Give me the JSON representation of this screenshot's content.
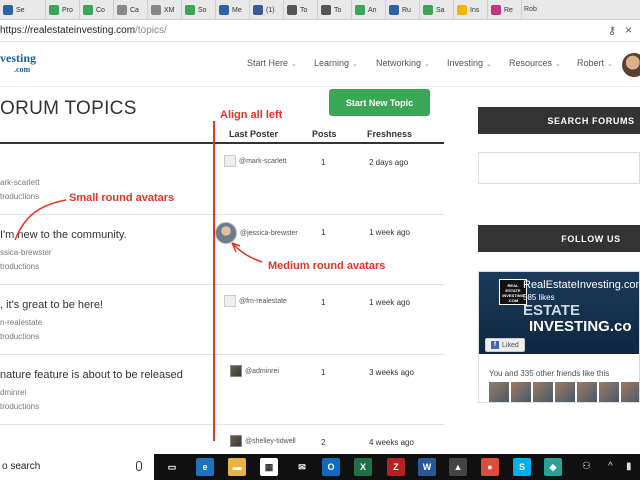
{
  "browser": {
    "tabs": [
      {
        "label": "Se",
        "color": "#2a62a8"
      },
      {
        "label": "Pro",
        "color": "#3aa757"
      },
      {
        "label": "Co",
        "color": "#3aa757"
      },
      {
        "label": "Ca",
        "color": "#888888"
      },
      {
        "label": "XM",
        "color": "#888888"
      },
      {
        "label": "So",
        "color": "#3aa757"
      },
      {
        "label": "Me",
        "color": "#2a62a8"
      },
      {
        "label": "(1)",
        "color": "#3b5998"
      },
      {
        "label": "To",
        "color": "#555555"
      },
      {
        "label": "To",
        "color": "#555555"
      },
      {
        "label": "An",
        "color": "#3aa757"
      },
      {
        "label": "Ru",
        "color": "#2a62a8"
      },
      {
        "label": "Sa",
        "color": "#3aa757"
      },
      {
        "label": "Ins",
        "color": "#f4b400"
      },
      {
        "label": "Re",
        "color": "#c13584"
      }
    ],
    "tab_overflow": "Rob",
    "url_host": "https://realestateinvesting.com",
    "url_path": "/topics/"
  },
  "site": {
    "logo_text": "vesting",
    "logo_sub": ".com",
    "nav": [
      {
        "label": "Start Here"
      },
      {
        "label": "Learning"
      },
      {
        "label": "Networking"
      },
      {
        "label": "Investing"
      },
      {
        "label": "Resources"
      },
      {
        "label": "Robert"
      }
    ]
  },
  "main": {
    "title": "ORUM TOPICS",
    "new_topic_label": "Start New Topic",
    "columns": {
      "last_poster": "Last Poster",
      "posts": "Posts",
      "freshness": "Freshness"
    },
    "topics": [
      {
        "title": "",
        "author": "ark-scarlett",
        "forum": "troductions",
        "poster": "@mark-scarlett",
        "avatar": "default",
        "posts": "1",
        "freshness": "2 days ago"
      },
      {
        "title": "I'm new to the community.",
        "author": "ssica-brewster",
        "forum": "troductions",
        "poster": "@jessica-brewster",
        "avatar": "round",
        "posts": "1",
        "freshness": "1 week ago"
      },
      {
        "title": ", it's great to be here!",
        "author": "n-realestate",
        "forum": "troductions",
        "poster": "@fm-realestate",
        "avatar": "default",
        "posts": "1",
        "freshness": "1 week ago"
      },
      {
        "title": "nature feature is about to be released",
        "author": "dminrei",
        "forum": "troductions",
        "poster": "@adminrei",
        "avatar": "photo",
        "posts": "1",
        "freshness": "3 weeks ago"
      },
      {
        "title": "",
        "author": "",
        "forum": "",
        "poster": "@shelley-tidwell",
        "avatar": "photo",
        "posts": "2",
        "freshness": "4 weeks ago"
      }
    ]
  },
  "sidebar": {
    "search_heading": "SEARCH FORUMS",
    "follow_heading": "FOLLOW US",
    "fb": {
      "logo_text": "REAL ESTATE INVESTING .COM",
      "page_name": "RealEstateInvesting.com",
      "likes": "585 likes",
      "banner_1": "ESTATE",
      "banner_2": "INVESTING.co",
      "liked_label": "Liked",
      "friends_text": "You and 335 other friends like this"
    }
  },
  "annotations": {
    "align_left": "Align all left",
    "small_avatars": "Small round avatars",
    "medium_avatars": "Medium round avatars",
    "color": "#e53328"
  },
  "taskbar": {
    "search_text": "o search",
    "apps": [
      {
        "name": "task-view",
        "glyph": "▭",
        "color": "#101010"
      },
      {
        "name": "edge",
        "glyph": "e",
        "color": "#1e73be"
      },
      {
        "name": "file-explorer",
        "glyph": "▬",
        "color": "#e8b341"
      },
      {
        "name": "store",
        "glyph": "▦",
        "color": "#ffffff"
      },
      {
        "name": "mail",
        "glyph": "✉",
        "color": "#101010"
      },
      {
        "name": "outlook",
        "glyph": "O",
        "color": "#0f6cbd"
      },
      {
        "name": "excel",
        "glyph": "X",
        "color": "#1e7145"
      },
      {
        "name": "filezilla",
        "glyph": "Z",
        "color": "#b22222"
      },
      {
        "name": "word",
        "glyph": "W",
        "color": "#2b579a"
      },
      {
        "name": "photos",
        "glyph": "▲",
        "color": "#444444"
      },
      {
        "name": "chrome",
        "glyph": "●",
        "color": "#dd4b39"
      },
      {
        "name": "skype",
        "glyph": "S",
        "color": "#00aff0"
      },
      {
        "name": "app",
        "glyph": "◆",
        "color": "#2aa198"
      }
    ]
  }
}
